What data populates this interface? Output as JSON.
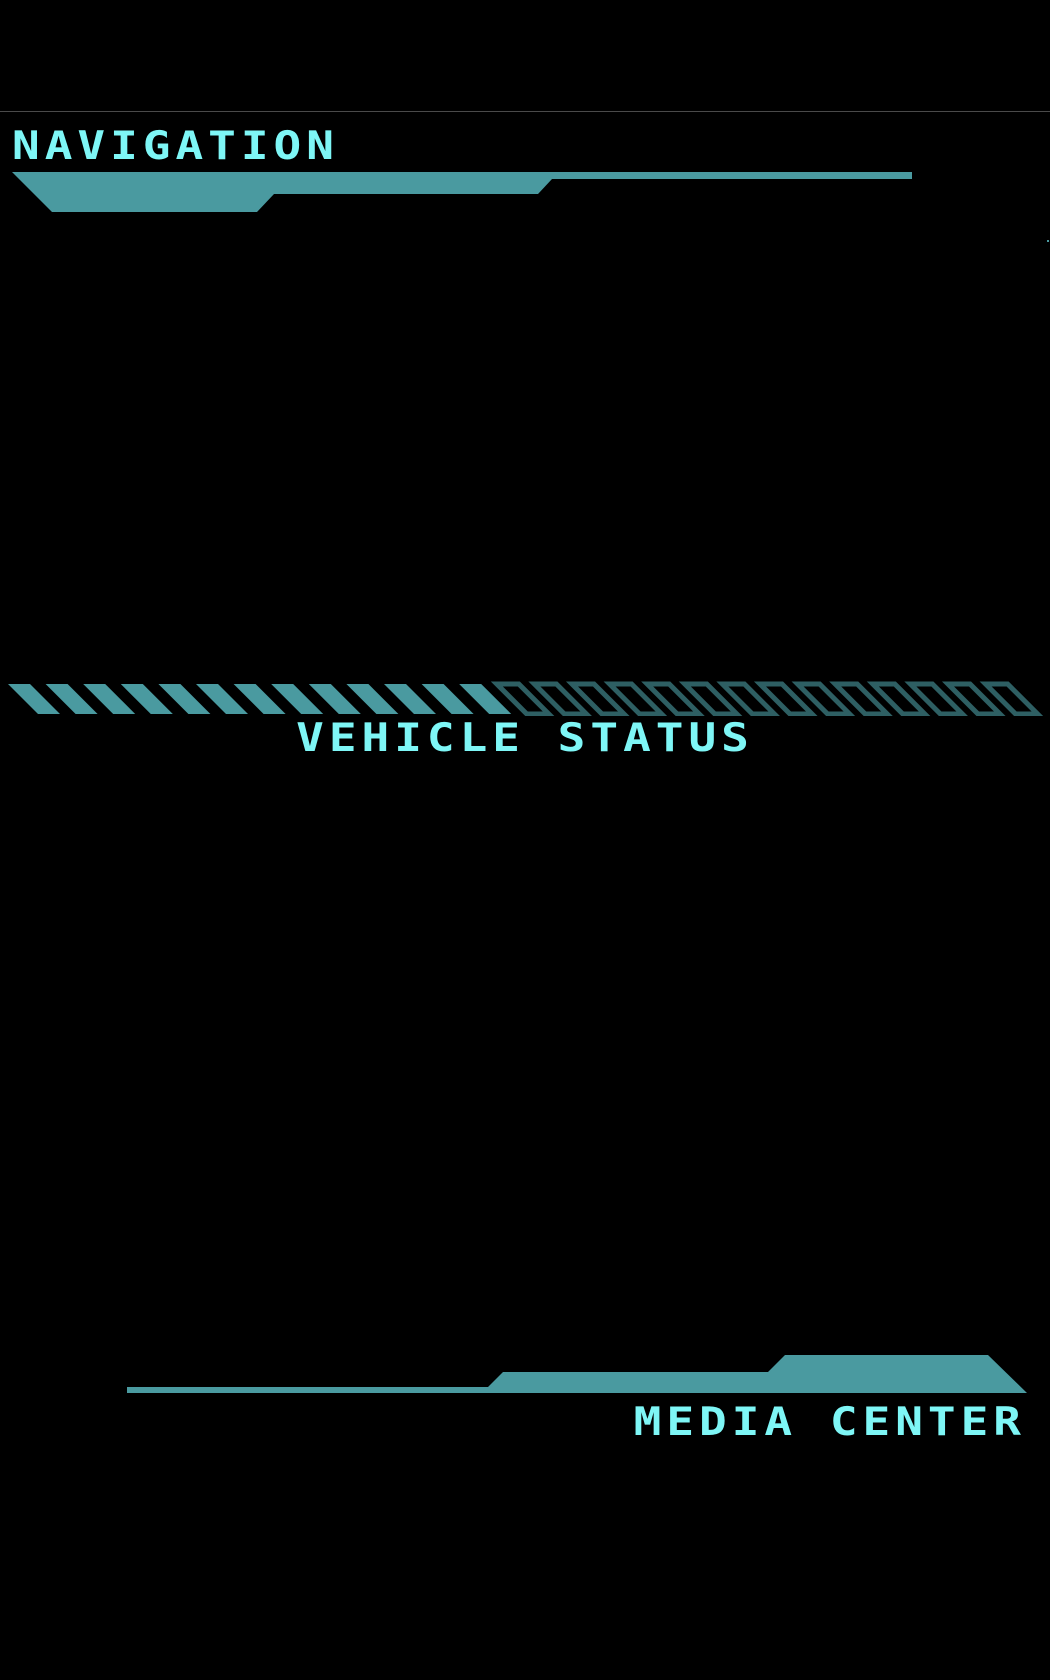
{
  "colors": {
    "background": "#000000",
    "title_text": "#7ef6f6",
    "accent": "#4a9aa0",
    "accent_dim": "#2e5f63",
    "rule": "#4a4a4a"
  },
  "sections": {
    "navigation": {
      "title": "NAVIGATION"
    },
    "vehicle_status": {
      "title": "VEHICLE STATUS",
      "filled_segments": 13,
      "total_segments": 27
    },
    "media_center": {
      "title": "MEDIA CENTER"
    }
  }
}
